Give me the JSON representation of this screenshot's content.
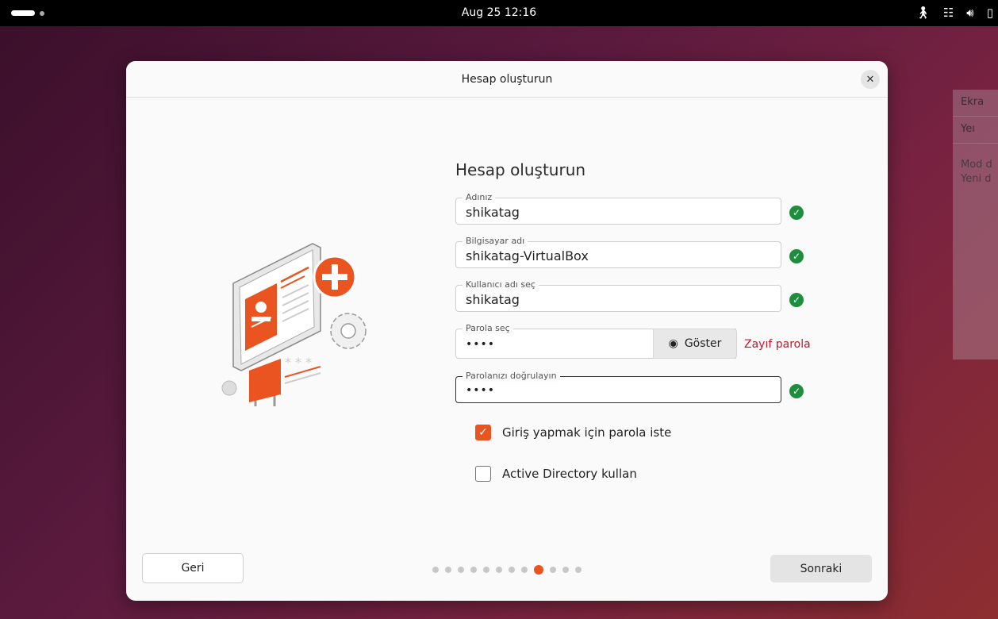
{
  "topbar": {
    "clock": "Aug 25  12:16",
    "icons": [
      "activities-pill",
      "accessibility-icon",
      "network-icon",
      "volume-icon",
      "battery-icon"
    ]
  },
  "background_panel": {
    "row1": "Ekra",
    "row2": "Yeı",
    "text1": "Mod d",
    "text2": "Yeni d"
  },
  "dialog": {
    "title": "Hesap oluşturun",
    "close_icon": "close-icon"
  },
  "form": {
    "title": "Hesap oluşturun",
    "name": {
      "label": "Adınız",
      "value": "shikatag"
    },
    "computer": {
      "label": "Bilgisayar adı",
      "value": "shikatag-VirtualBox"
    },
    "username": {
      "label": "Kullanıcı adı seç",
      "value": "shikatag"
    },
    "password": {
      "label": "Parola seç",
      "value": "••••",
      "show_label": "Göster",
      "strength": "Zayıf parola"
    },
    "confirm": {
      "label": "Parolanızı doğrulayın",
      "value": "••••"
    },
    "require_password": {
      "label": "Giriş yapmak için parola iste",
      "checked": true
    },
    "active_directory": {
      "label": "Active Directory kullan",
      "checked": false
    }
  },
  "footer": {
    "back_label": "Geri",
    "next_label": "Sonraki",
    "pages_total": 12,
    "page_current": 9
  },
  "colors": {
    "accent": "#e95420",
    "success": "#1e8e3e",
    "warning_text": "#c7162b"
  }
}
